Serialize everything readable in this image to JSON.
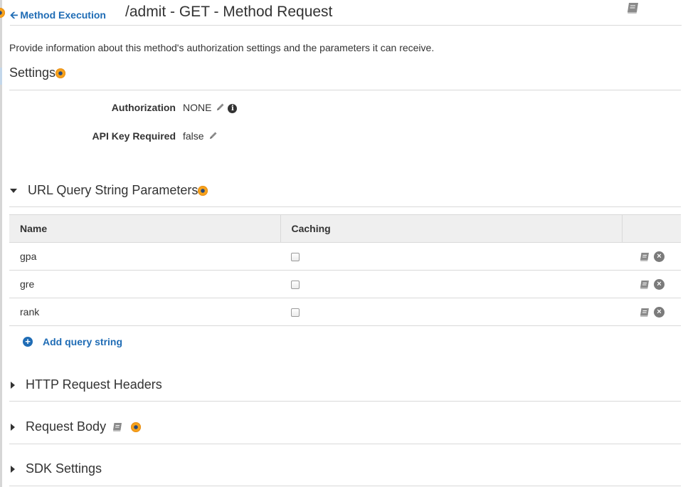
{
  "header": {
    "back_label": "Method Execution",
    "title": "/admit - GET - Method Request",
    "docs_icon": "book-icon"
  },
  "description": "Provide information about this method's authorization settings and the parameters it can receive.",
  "settings": {
    "title": "Settings",
    "authorization_label": "Authorization",
    "authorization_value": "NONE",
    "api_key_label": "API Key Required",
    "api_key_value": "false"
  },
  "query_params": {
    "title": "URL Query String Parameters",
    "expanded": true,
    "columns": [
      "Name",
      "Caching",
      ""
    ],
    "rows": [
      {
        "name": "gpa",
        "caching": false
      },
      {
        "name": "gre",
        "caching": false
      },
      {
        "name": "rank",
        "caching": false
      }
    ],
    "add_label": "Add query string"
  },
  "sections": {
    "http_headers": "HTTP Request Headers",
    "request_body": "Request Body",
    "sdk_settings": "SDK Settings"
  },
  "colors": {
    "link": "#1f6cb5",
    "table_header_bg": "#efefef",
    "border": "#d9d9d9",
    "help_dot": "#f7a21b"
  },
  "icons": {
    "help": "help-dot-icon",
    "edit": "pencil-icon",
    "info": "info-icon",
    "docs": "book-icon",
    "remove": "close-circle-icon",
    "add": "plus-circle-icon"
  }
}
